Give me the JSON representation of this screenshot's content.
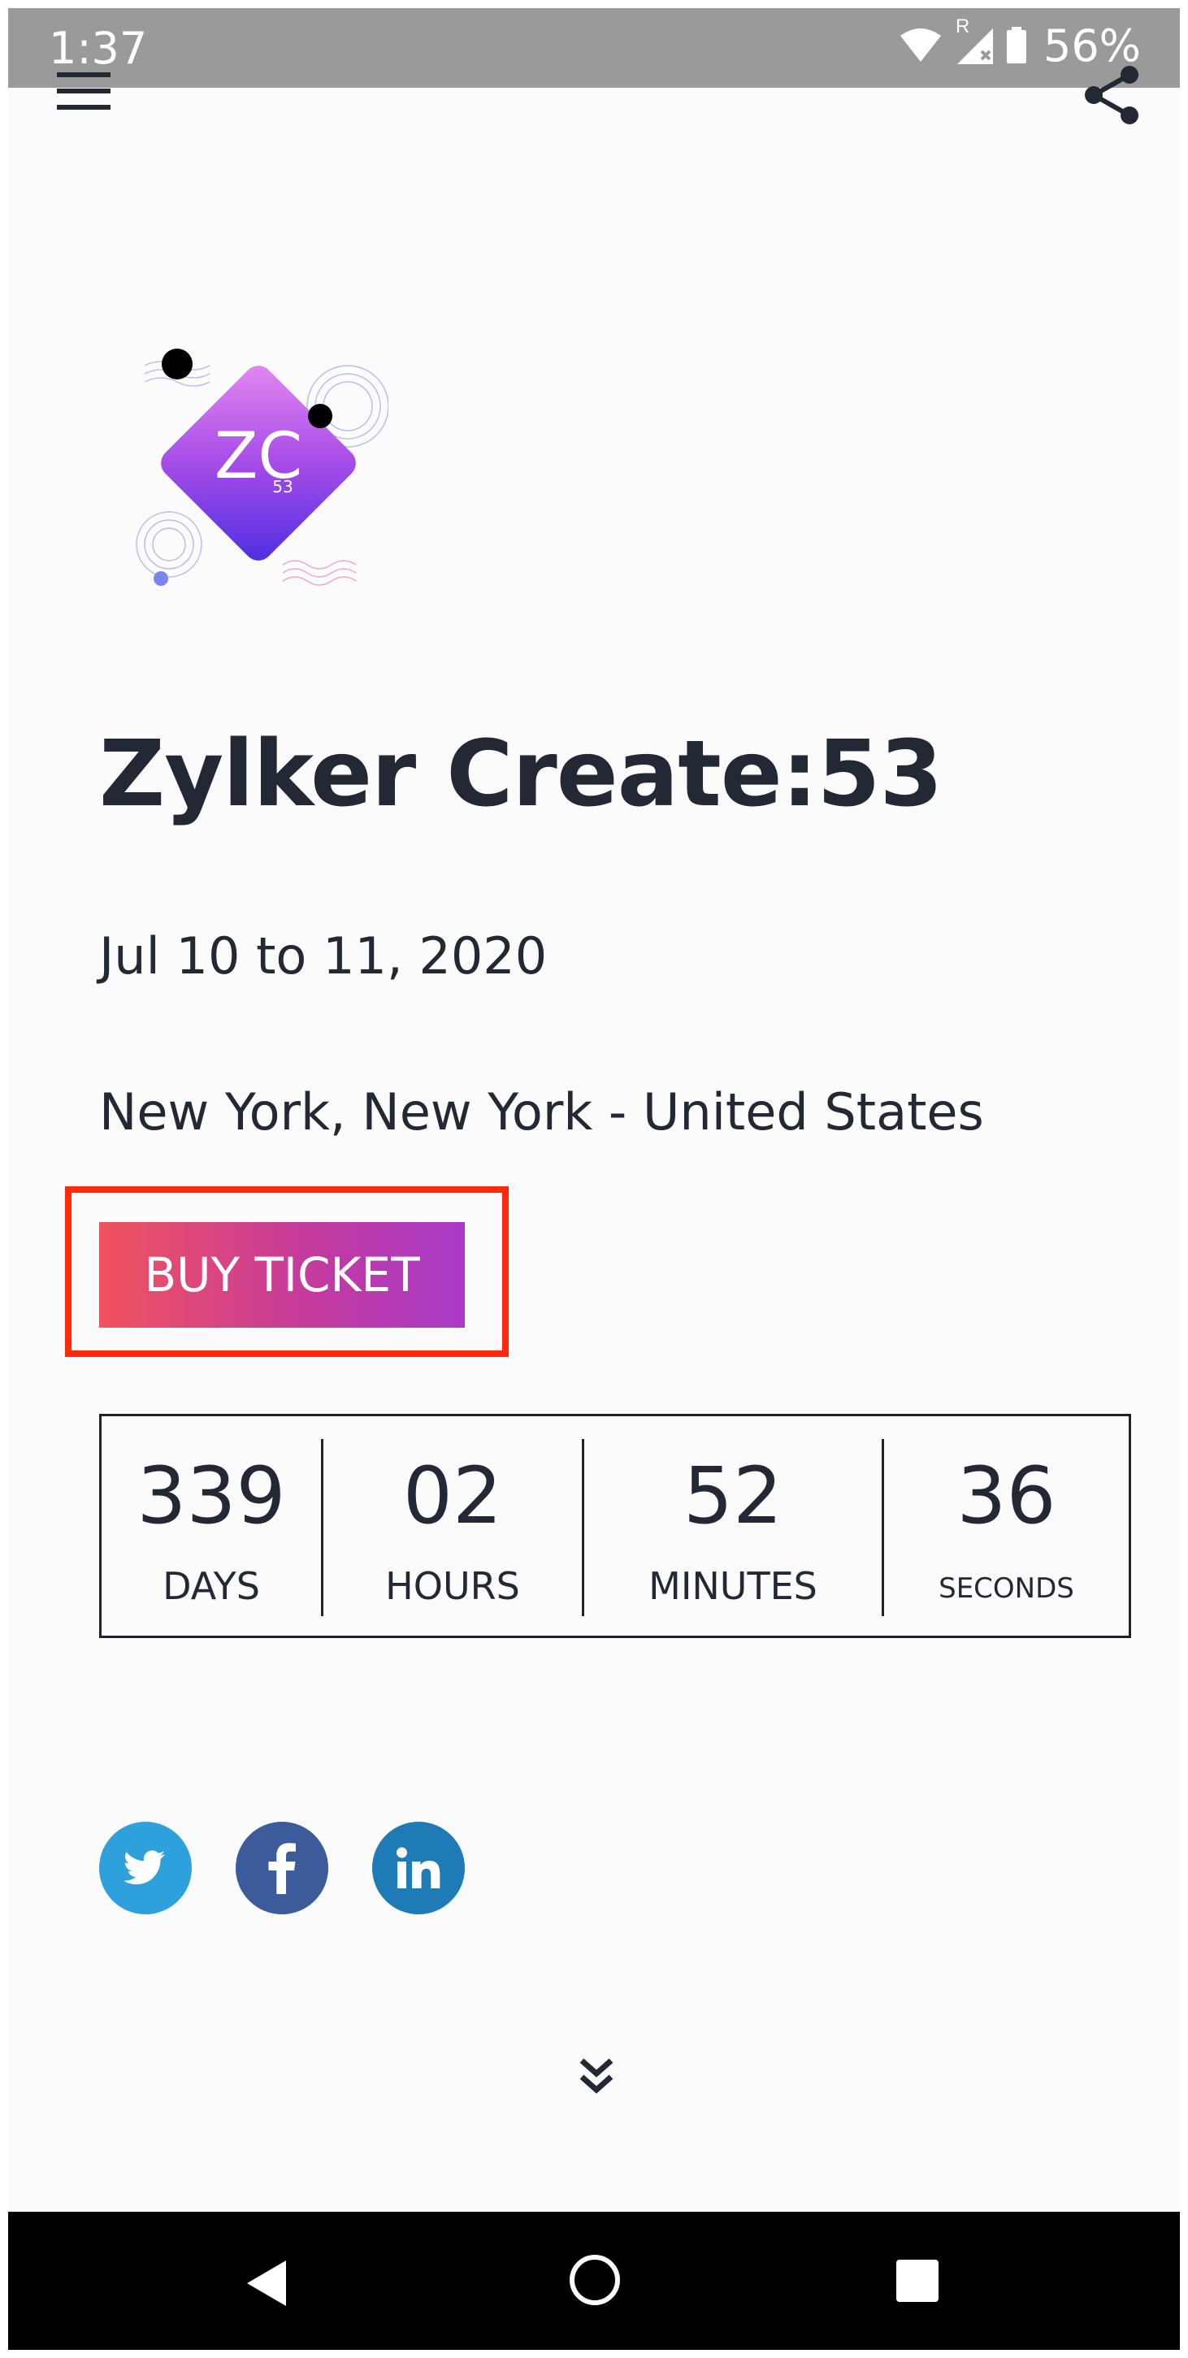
{
  "status_bar": {
    "time": "1:37",
    "signal_label": "R",
    "battery": "56%"
  },
  "event": {
    "title": "Zylker Create:53",
    "date": "Jul 10 to 11, 2020",
    "location": "New York, New York - United States",
    "buy_button": "BUY TICKET",
    "logo_text": "ZC",
    "logo_number": "53"
  },
  "countdown": [
    {
      "value": "339",
      "label": "DAYS"
    },
    {
      "value": "02",
      "label": "HOURS"
    },
    {
      "value": "52",
      "label": "MINUTES"
    },
    {
      "value": "36",
      "label": "SECONDS"
    }
  ],
  "social": [
    {
      "icon": "twitter-icon",
      "color": "#2ea1dd"
    },
    {
      "icon": "facebook-icon",
      "color": "#3b5b9b"
    },
    {
      "icon": "linkedin-icon",
      "color": "#1e7bb5"
    }
  ],
  "colors": {
    "text": "#222934",
    "buy_gradient_start": "#f1525e",
    "buy_gradient_end": "#a93ac8",
    "highlight": "#ff2a0c"
  }
}
